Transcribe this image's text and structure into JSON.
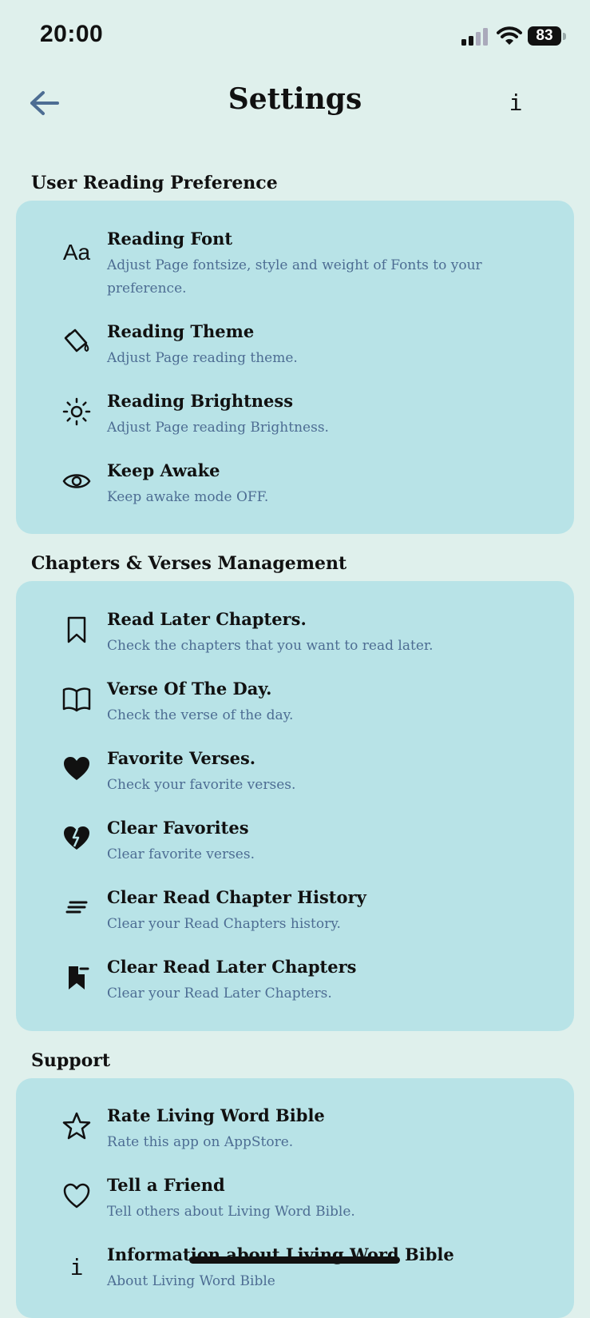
{
  "status_bar": {
    "time": "20:00",
    "battery": "83"
  },
  "header": {
    "title": "Settings",
    "info_label": "i"
  },
  "sections": [
    {
      "title": "User Reading Preference",
      "items": [
        {
          "icon": "font-icon",
          "icon_text": "Aa",
          "title": "Reading Font",
          "subtitle": "Adjust Page fontsize, style and weight of Fonts to your preference."
        },
        {
          "icon": "paint-bucket-icon",
          "title": "Reading Theme",
          "subtitle": "Adjust Page reading theme."
        },
        {
          "icon": "sun-icon",
          "title": "Reading Brightness",
          "subtitle": "Adjust Page reading Brightness."
        },
        {
          "icon": "eye-icon",
          "title": "Keep Awake",
          "subtitle": "Keep awake mode OFF."
        }
      ]
    },
    {
      "title": "Chapters & Verses Management",
      "items": [
        {
          "icon": "bookmark-icon",
          "title": "Read Later Chapters.",
          "subtitle": "Check the chapters that you want to read later."
        },
        {
          "icon": "open-book-icon",
          "title": "Verse Of The Day.",
          "subtitle": "Check the verse of the day."
        },
        {
          "icon": "heart-filled-icon",
          "title": "Favorite Verses.",
          "subtitle": "Check your favorite verses."
        },
        {
          "icon": "broken-heart-icon",
          "title": "Clear Favorites",
          "subtitle": "Clear favorite verses."
        },
        {
          "icon": "clear-lines-icon",
          "title": "Clear Read Chapter History",
          "subtitle": "Clear your Read Chapters history."
        },
        {
          "icon": "bookmark-remove-icon",
          "title": "Clear Read Later Chapters",
          "subtitle": "Clear your Read Later Chapters."
        }
      ]
    },
    {
      "title": "Support",
      "items": [
        {
          "icon": "star-icon",
          "title": "Rate Living Word Bible",
          "subtitle": "Rate this app on AppStore."
        },
        {
          "icon": "heart-outline-icon",
          "title": "Tell a Friend",
          "subtitle": "Tell others about Living Word Bible."
        },
        {
          "icon": "info-icon",
          "icon_text": "i",
          "title": "Information about Living Word Bible",
          "subtitle": "About Living Word Bible"
        }
      ]
    }
  ]
}
